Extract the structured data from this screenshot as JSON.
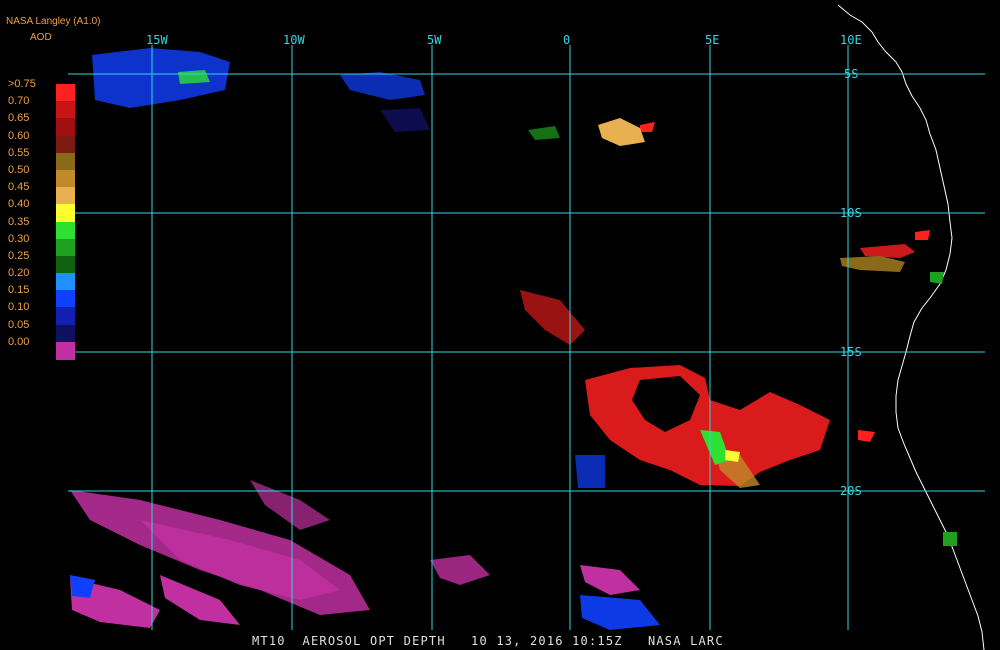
{
  "header": {
    "title": "NASA Langley (A1.0)",
    "product": "AOD"
  },
  "legend": {
    "labels": [
      ">0.75",
      "0.70",
      "0.65",
      "0.60",
      "0.55",
      "0.50",
      "0.45",
      "0.40",
      "0.35",
      "0.30",
      "0.25",
      "0.20",
      "0.15",
      "0.10",
      "0.05",
      "0.00"
    ],
    "colors": [
      "#ff2020",
      "#c81414",
      "#a01010",
      "#7a1a10",
      "#8a6a1a",
      "#c08a28",
      "#e8b050",
      "#ffff30",
      "#30e030",
      "#20a020",
      "#106010",
      "#2090ff",
      "#1040ff",
      "#1020b0",
      "#101060",
      "#c030a0"
    ]
  },
  "grid": {
    "lon_labels": [
      "15W",
      "10W",
      "5W",
      "0",
      "5E",
      "10E"
    ],
    "lat_labels": [
      "5S",
      "10S",
      "15S",
      "20S"
    ]
  },
  "footer": {
    "text": "MT10  AEROSOL OPT DEPTH   10 13, 2016 10:15Z   NASA LARC"
  }
}
